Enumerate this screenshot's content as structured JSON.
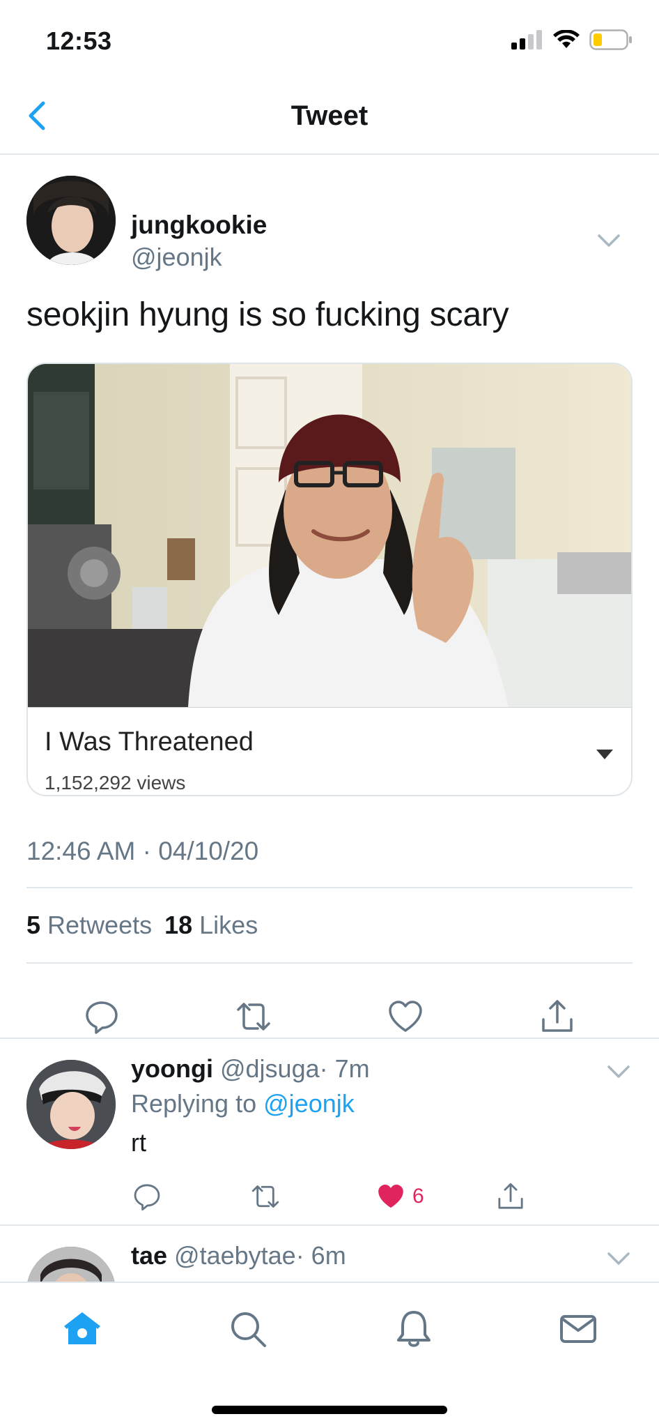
{
  "status_bar": {
    "time": "12:53"
  },
  "nav": {
    "title": "Tweet"
  },
  "tweet": {
    "author_name": "jungkookie",
    "author_handle": "@jeonjk",
    "text": "seokjin hyung is so fucking scary",
    "media": {
      "title": "I Was Threatened",
      "views": "1,152,292 views"
    },
    "timestamp": "12:46 AM · 04/10/20",
    "retweet_count": "5",
    "retweets_label": "Retweets",
    "like_count": "18",
    "likes_label": "Likes"
  },
  "replies": [
    {
      "name": "yoongi",
      "handle": "@djsuga",
      "time": "· 7m",
      "replying_prefix": "Replying to",
      "replying_mention": "@jeonjk",
      "text": "rt",
      "like_count": "6"
    },
    {
      "name": "tae",
      "handle": "@taebytae",
      "time": "· 6m"
    }
  ],
  "colors": {
    "accent": "#1da1f2",
    "like": "#e0245e",
    "muted": "#657786",
    "divider": "#e1e8ed"
  },
  "icons": {
    "back": "chevron-left-icon",
    "reply": "comment-icon",
    "retweet": "retweet-icon",
    "like": "heart-icon",
    "share": "share-icon",
    "tabs": [
      "home-icon",
      "search-icon",
      "bell-icon",
      "mail-icon"
    ]
  }
}
